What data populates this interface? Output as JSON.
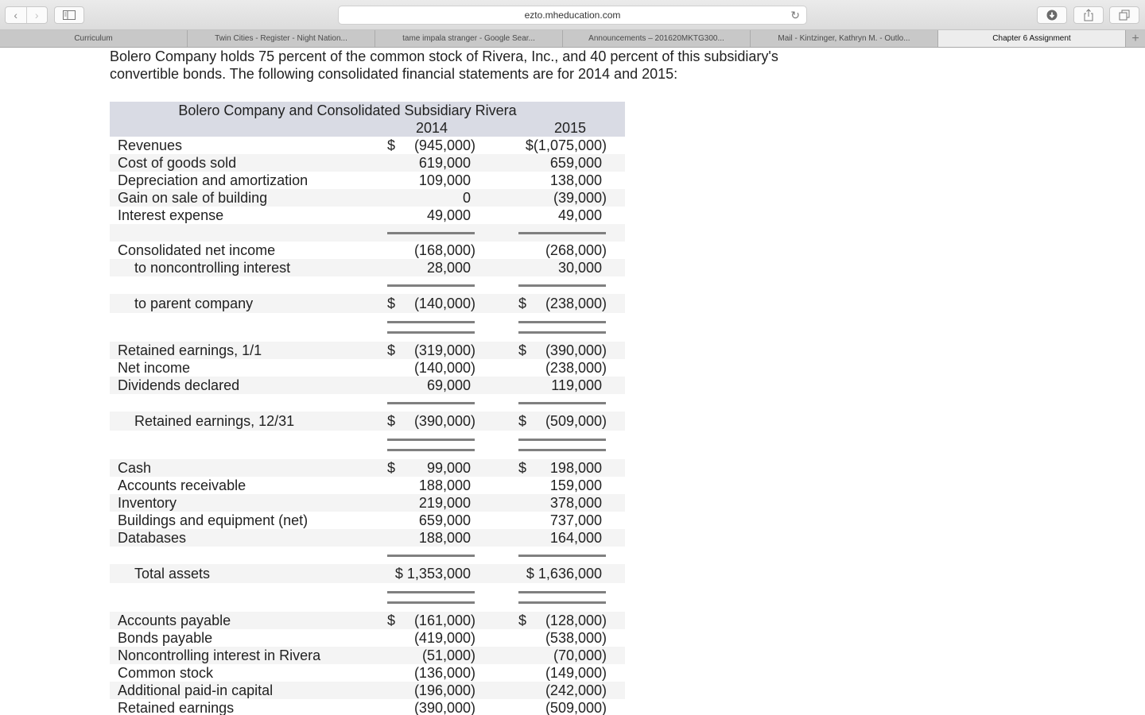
{
  "browser": {
    "url": "ezto.mheducation.com",
    "tabs": [
      {
        "label": "Curriculum",
        "active": false
      },
      {
        "label": "Twin Cities - Register - Night Nation...",
        "active": false
      },
      {
        "label": "tame impala stranger - Google Sear...",
        "active": false
      },
      {
        "label": "Announcements – 201620MKTG300...",
        "active": false
      },
      {
        "label": "Mail - Kintzinger, Kathryn M. - Outlo...",
        "active": false
      },
      {
        "label": "Chapter 6 Assignment",
        "active": true
      }
    ],
    "icons": {
      "back": "‹",
      "forward": "›",
      "reload": "↻",
      "new_tab": "+"
    }
  },
  "intro": "Bolero Company holds 75 percent of the common stock of Rivera, Inc., and 40 percent of this subsidiary's convertible bonds. The following consolidated financial statements are for 2014 and 2015:",
  "statement": {
    "title": "Bolero Company and Consolidated Subsidiary Rivera",
    "years": [
      "2014",
      "2015"
    ],
    "income": [
      {
        "label": "Revenues",
        "v2014": {
          "cur": "$",
          "num": "(945,000)"
        },
        "v2015": {
          "cur": "",
          "num": "$(1,075,000)"
        }
      },
      {
        "label": "Cost of goods sold",
        "v2014": {
          "cur": "",
          "num": "619,000"
        },
        "v2015": {
          "cur": "",
          "num": "659,000"
        }
      },
      {
        "label": "Depreciation and amortization",
        "v2014": {
          "cur": "",
          "num": "109,000"
        },
        "v2015": {
          "cur": "",
          "num": "138,000"
        }
      },
      {
        "label": "Gain on sale of building",
        "v2014": {
          "cur": "",
          "num": "0"
        },
        "v2015": {
          "cur": "",
          "num": "(39,000)"
        }
      },
      {
        "label": "Interest expense",
        "v2014": {
          "cur": "",
          "num": "49,000"
        },
        "v2015": {
          "cur": "",
          "num": "49,000"
        }
      }
    ],
    "net_income": [
      {
        "label": "Consolidated net income",
        "v2014": {
          "cur": "",
          "num": "(168,000)"
        },
        "v2015": {
          "cur": "",
          "num": "(268,000)"
        }
      },
      {
        "label": "to noncontrolling interest",
        "v2014": {
          "cur": "",
          "num": "28,000"
        },
        "v2015": {
          "cur": "",
          "num": "30,000"
        }
      }
    ],
    "to_parent": {
      "label": "to parent company",
      "v2014": {
        "cur": "$",
        "num": "(140,000)"
      },
      "v2015": {
        "cur": "$",
        "num": "(238,000)"
      }
    },
    "retained": [
      {
        "label": "Retained earnings, 1/1",
        "v2014": {
          "cur": "$",
          "num": "(319,000)"
        },
        "v2015": {
          "cur": "$",
          "num": "(390,000)"
        }
      },
      {
        "label": "Net income",
        "v2014": {
          "cur": "",
          "num": "(140,000)"
        },
        "v2015": {
          "cur": "",
          "num": "(238,000)"
        }
      },
      {
        "label": "Dividends declared",
        "v2014": {
          "cur": "",
          "num": "69,000"
        },
        "v2015": {
          "cur": "",
          "num": "119,000"
        }
      }
    ],
    "retained_end": {
      "label": "Retained earnings, 12/31",
      "v2014": {
        "cur": "$",
        "num": "(390,000)"
      },
      "v2015": {
        "cur": "$",
        "num": "(509,000)"
      }
    },
    "assets": [
      {
        "label": "Cash",
        "v2014": {
          "cur": "$",
          "num": "99,000"
        },
        "v2015": {
          "cur": "$",
          "num": "198,000"
        }
      },
      {
        "label": "Accounts receivable",
        "v2014": {
          "cur": "",
          "num": "188,000"
        },
        "v2015": {
          "cur": "",
          "num": "159,000"
        }
      },
      {
        "label": "Inventory",
        "v2014": {
          "cur": "",
          "num": "219,000"
        },
        "v2015": {
          "cur": "",
          "num": "378,000"
        }
      },
      {
        "label": "Buildings and equipment (net)",
        "v2014": {
          "cur": "",
          "num": "659,000"
        },
        "v2015": {
          "cur": "",
          "num": "737,000"
        }
      },
      {
        "label": "Databases",
        "v2014": {
          "cur": "",
          "num": "188,000"
        },
        "v2015": {
          "cur": "",
          "num": "164,000"
        }
      }
    ],
    "total_assets": {
      "label": "Total assets",
      "v2014": {
        "cur": "",
        "num": "$ 1,353,000"
      },
      "v2015": {
        "cur": "",
        "num": "$ 1,636,000"
      }
    },
    "liabilities": [
      {
        "label": "Accounts payable",
        "v2014": {
          "cur": "$",
          "num": "(161,000)"
        },
        "v2015": {
          "cur": "$",
          "num": "(128,000)"
        }
      },
      {
        "label": "Bonds payable",
        "v2014": {
          "cur": "",
          "num": "(419,000)"
        },
        "v2015": {
          "cur": "",
          "num": "(538,000)"
        }
      },
      {
        "label": "Noncontrolling interest in Rivera",
        "v2014": {
          "cur": "",
          "num": "(51,000)"
        },
        "v2015": {
          "cur": "",
          "num": "(70,000)"
        }
      },
      {
        "label": "Common stock",
        "v2014": {
          "cur": "",
          "num": "(136,000)"
        },
        "v2015": {
          "cur": "",
          "num": "(149,000)"
        }
      },
      {
        "label": "Additional paid-in capital",
        "v2014": {
          "cur": "",
          "num": "(196,000)"
        },
        "v2015": {
          "cur": "",
          "num": "(242,000)"
        }
      },
      {
        "label": "Retained earnings",
        "v2014": {
          "cur": "",
          "num": "(390,000)"
        },
        "v2015": {
          "cur": "",
          "num": "(509,000)"
        }
      }
    ]
  }
}
